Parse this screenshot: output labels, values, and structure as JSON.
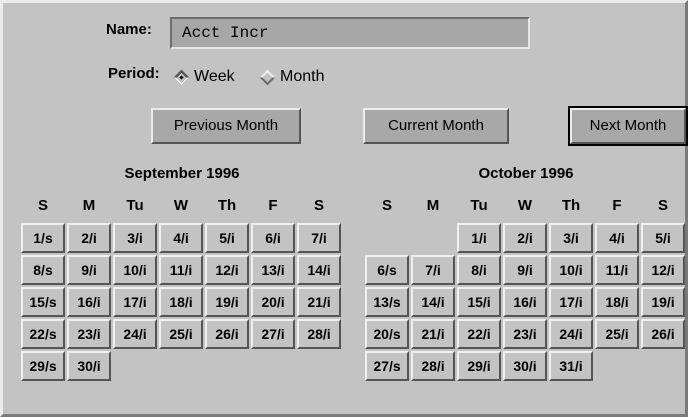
{
  "form": {
    "name_label": "Name:",
    "name_value": "Acct Incr",
    "period_label": "Period:",
    "period_options": [
      "Week",
      "Month"
    ],
    "period_selected": "Week"
  },
  "buttons": {
    "previous": "Previous Month",
    "current": "Current Month",
    "next": "Next Month"
  },
  "weekday_headers": [
    "S",
    "M",
    "Tu",
    "W",
    "Th",
    "F",
    "S"
  ],
  "months": [
    {
      "title": "September 1996",
      "weeks": [
        [
          "1/s",
          "2/i",
          "3/i",
          "4/i",
          "5/i",
          "6/i",
          "7/i"
        ],
        [
          "8/s",
          "9/i",
          "10/i",
          "11/i",
          "12/i",
          "13/i",
          "14/i"
        ],
        [
          "15/s",
          "16/i",
          "17/i",
          "18/i",
          "19/i",
          "20/i",
          "21/i"
        ],
        [
          "22/s",
          "23/i",
          "24/i",
          "25/i",
          "26/i",
          "27/i",
          "28/i"
        ],
        [
          "29/s",
          "30/i",
          "",
          "",
          "",
          "",
          ""
        ]
      ]
    },
    {
      "title": "October 1996",
      "weeks": [
        [
          "",
          "",
          "1/i",
          "2/i",
          "3/i",
          "4/i",
          "5/i"
        ],
        [
          "6/s",
          "7/i",
          "8/i",
          "9/i",
          "10/i",
          "11/i",
          "12/i"
        ],
        [
          "13/s",
          "14/i",
          "15/i",
          "16/i",
          "17/i",
          "18/i",
          "19/i"
        ],
        [
          "20/s",
          "21/i",
          "22/i",
          "23/i",
          "24/i",
          "25/i",
          "26/i"
        ],
        [
          "27/s",
          "28/i",
          "29/i",
          "30/i",
          "31/i",
          "",
          ""
        ]
      ]
    }
  ]
}
